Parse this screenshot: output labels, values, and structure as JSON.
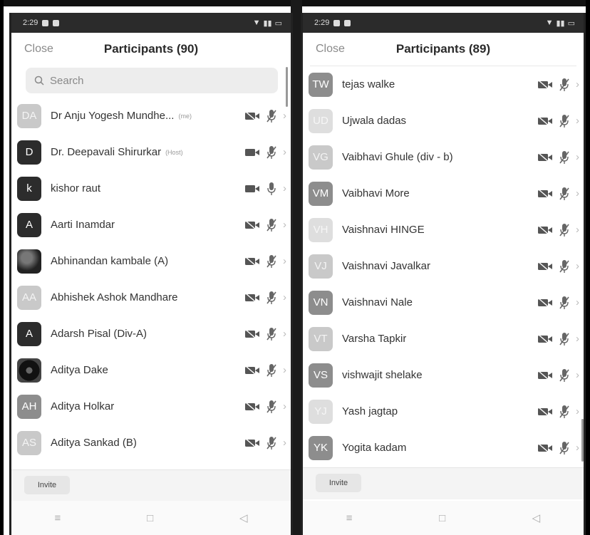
{
  "left": {
    "status": {
      "time": "2:29"
    },
    "close_label": "Close",
    "title": "Participants (90)",
    "search_placeholder": "Search",
    "invite_label": "Invite",
    "participants": [
      {
        "initials": "DA",
        "name": "Dr Anju Yogesh Mundhe...",
        "tag": "(me)",
        "avatar": "light",
        "video": "off",
        "mic": "muted"
      },
      {
        "initials": "D",
        "name": "Dr. Deepavali Shirurkar",
        "tag": "(Host)",
        "avatar": "dark",
        "video": "on",
        "mic": "muted"
      },
      {
        "initials": "k",
        "name": "kishor raut",
        "tag": "",
        "avatar": "dark",
        "video": "on",
        "mic": "on"
      },
      {
        "initials": "A",
        "name": "Aarti Inamdar",
        "tag": "",
        "avatar": "dark",
        "video": "off",
        "mic": "muted"
      },
      {
        "initials": "",
        "name": "Abhinandan kambale (A)",
        "tag": "",
        "avatar": "photo",
        "video": "off",
        "mic": "muted"
      },
      {
        "initials": "AA",
        "name": "Abhishek Ashok Mandhare",
        "tag": "",
        "avatar": "light",
        "video": "off",
        "mic": "muted"
      },
      {
        "initials": "A",
        "name": "Adarsh Pisal (Div-A)",
        "tag": "",
        "avatar": "dark",
        "video": "off",
        "mic": "muted"
      },
      {
        "initials": "",
        "name": "Aditya Dake",
        "tag": "",
        "avatar": "disc",
        "video": "off",
        "mic": "muted"
      },
      {
        "initials": "AH",
        "name": "Aditya Holkar",
        "tag": "",
        "avatar": "mid",
        "video": "off",
        "mic": "muted"
      },
      {
        "initials": "AS",
        "name": "Aditya Sankad (B)",
        "tag": "",
        "avatar": "light",
        "video": "off",
        "mic": "muted"
      }
    ]
  },
  "right": {
    "status": {
      "time": "2:29"
    },
    "close_label": "Close",
    "title": "Participants (89)",
    "invite_label": "Invite",
    "participants": [
      {
        "initials": "TW",
        "name": "tejas walke",
        "avatar": "mid",
        "video": "off",
        "mic": "muted"
      },
      {
        "initials": "UD",
        "name": "Ujwala dadas",
        "avatar": "vlight",
        "video": "off",
        "mic": "muted"
      },
      {
        "initials": "VG",
        "name": "Vaibhavi Ghule (div - b)",
        "avatar": "light",
        "video": "off",
        "mic": "muted"
      },
      {
        "initials": "VM",
        "name": "Vaibhavi More",
        "avatar": "mid",
        "video": "off",
        "mic": "muted"
      },
      {
        "initials": "VH",
        "name": "Vaishnavi HINGE",
        "avatar": "vlight",
        "video": "off",
        "mic": "muted"
      },
      {
        "initials": "VJ",
        "name": "Vaishnavi Javalkar",
        "avatar": "light",
        "video": "off",
        "mic": "muted"
      },
      {
        "initials": "VN",
        "name": "Vaishnavi Nale",
        "avatar": "mid",
        "video": "off",
        "mic": "muted"
      },
      {
        "initials": "VT",
        "name": "Varsha Tapkir",
        "avatar": "light",
        "video": "off",
        "mic": "muted"
      },
      {
        "initials": "VS",
        "name": "vishwajit shelake",
        "avatar": "mid",
        "video": "off",
        "mic": "muted"
      },
      {
        "initials": "YJ",
        "name": "Yash jagtap",
        "avatar": "vlight",
        "video": "off",
        "mic": "muted"
      },
      {
        "initials": "YK",
        "name": "Yogita kadam",
        "avatar": "mid",
        "video": "off",
        "mic": "muted"
      }
    ]
  },
  "icons": {
    "video_off": "video-off-icon",
    "video_on": "video-icon",
    "mic_muted": "mic-muted-icon",
    "mic_on": "mic-icon",
    "chevron": "chevron-right-icon"
  }
}
